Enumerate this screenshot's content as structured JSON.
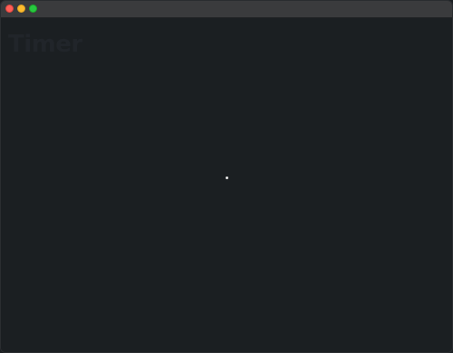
{
  "window": {
    "controls": {
      "close_icon": "close-icon",
      "minimize_icon": "minimize-icon",
      "zoom_icon": "zoom-icon"
    },
    "colors": {
      "background": "#1b1f22",
      "titlebar": "#3a3b3d",
      "close": "#ff5f57",
      "minimize": "#febc2e",
      "zoom": "#28c840"
    }
  },
  "content": {
    "faint_title": "Timer"
  }
}
